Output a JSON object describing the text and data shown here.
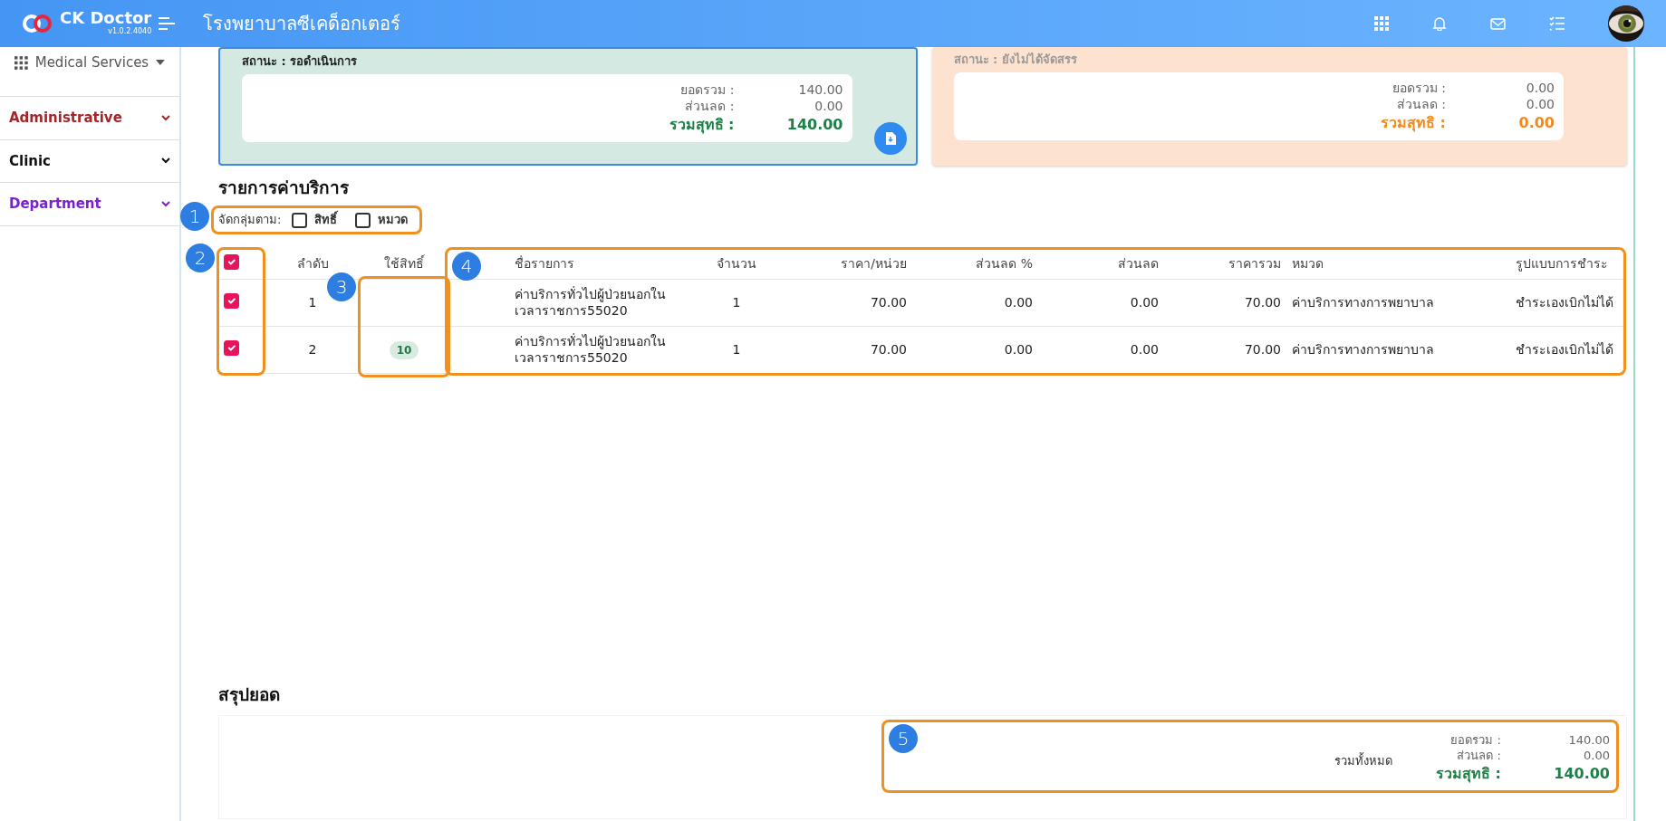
{
  "app": {
    "name": "CK Doctor",
    "version": "v1.0.2.4040"
  },
  "hospital": "โรงพยาบาลซีเคด็อกเตอร์",
  "sidebar": {
    "menu": "Medical Services",
    "sections": [
      {
        "label": "Administrative",
        "color": "#a3262a"
      },
      {
        "label": "Clinic",
        "color": "#111111"
      },
      {
        "label": "Department",
        "color": "#7a1fd1"
      }
    ]
  },
  "status_cards": [
    {
      "kind": "pending",
      "status": "สถานะ : รอดำเนินการ",
      "rows": [
        {
          "label": "ยอดรวม :",
          "value": "140.00"
        },
        {
          "label": "ส่วนลด :",
          "value": "0.00"
        }
      ],
      "net_label": "รวมสุทธิ :",
      "net_value": "140.00"
    },
    {
      "kind": "unallocated",
      "status": "สถานะ : ยังไม่ได้จัดสรร",
      "rows": [
        {
          "label": "ยอดรวม :",
          "value": "0.00"
        },
        {
          "label": "ส่วนลด :",
          "value": "0.00"
        }
      ],
      "net_label": "รวมสุทธิ :",
      "net_value": "0.00"
    }
  ],
  "section_title": "รายการค่าบริการ",
  "group_by": {
    "label": "จัดกลุ่มตาม:",
    "options": [
      {
        "label": "สิทธิ์",
        "checked": false
      },
      {
        "label": "หมวด",
        "checked": false
      }
    ]
  },
  "table": {
    "header_checked": true,
    "columns": [
      "ลำดับ",
      "ใช้สิทธิ์",
      "ชื่อรายการ",
      "จำนวน",
      "ราคา/หน่วย",
      "ส่วนลด %",
      "ส่วนลด",
      "ราคารวม",
      "หมวด",
      "รูปแบบการชำระ"
    ],
    "rows": [
      {
        "checked": true,
        "cells": [
          "1",
          "",
          "ค่าบริการทั่วไปผู้ป่วยนอกในเวลาราชการ55020",
          "1",
          "70.00",
          "0.00",
          "0.00",
          "70.00",
          "ค่าบริการทางการพยาบาล",
          "ชำระเองเบิกไม่ได้"
        ]
      },
      {
        "checked": true,
        "cells": [
          "2",
          "10",
          "ค่าบริการทั่วไปผู้ป่วยนอกในเวลาราชการ55020",
          "1",
          "70.00",
          "0.00",
          "0.00",
          "70.00",
          "ค่าบริการทางการพยาบาล",
          "ชำระเองเบิกไม่ได้"
        ]
      }
    ]
  },
  "summary": {
    "title": "สรุปยอด",
    "caption": "รวมทั้งหมด",
    "rows": [
      {
        "label": "ยอดรวม :",
        "value": "140.00"
      },
      {
        "label": "ส่วนลด :",
        "value": "0.00"
      }
    ],
    "net_label": "รวมสุทธิ :",
    "net_value": "140.00"
  },
  "annotations": [
    {
      "number": "1"
    },
    {
      "number": "2"
    },
    {
      "number": "3"
    },
    {
      "number": "4"
    },
    {
      "number": "5"
    }
  ]
}
